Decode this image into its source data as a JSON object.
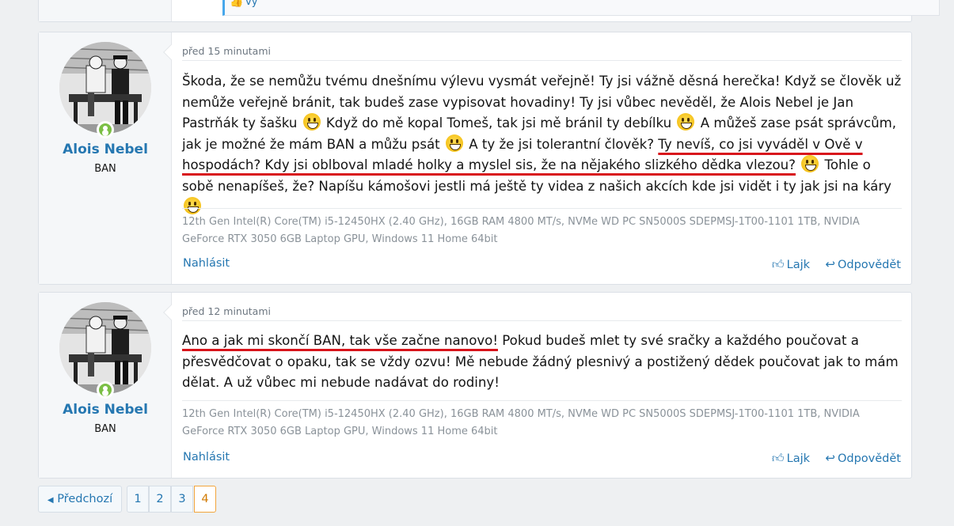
{
  "top_remnant": {
    "reaction_text": "vy"
  },
  "posts": [
    {
      "author": "Alois Nebel",
      "user_title": "BAN",
      "time": "před 15 minutami",
      "body": {
        "p1": "Škoda, že se nemůžu tvému dnešnímu výlevu vysmát veřejně! Ty jsi vážně děsná herečka! Když se člověk už nemůže veřejně bránit, tak budeš zase vypisovat hovadiny! Ty jsi vůbec nevěděl, že Alois Nebel je Jan Pastrňák ty šašku",
        "p2": "Když do mě kopal Tomeš, tak jsi mě bránil ty debílku",
        "p3": "A můžeš zase psát správcům, jak je možné že mám BAN a můžu psát",
        "p4": "A ty že jsi tolerantní člověk?",
        "p5_underlined": "Ty nevíš, co jsi vyváděl v Ově v hospodách? Kdy jsi oblboval mladé holky a myslel sis, že na nějakého slizkého dědka vlezou?",
        "p6": "Tohle o sobě nenapíšeš, že? Napíšu kámošovi jestli má ještě ty videa z našich akcích kde jsi vidět i ty jak jsi na káry"
      },
      "signature": "12th Gen Intel(R) Core(TM) i5-12450HX (2.40 GHz), 16GB RAM 4800 MT/s, NVMe WD PC SN5000S SDEPMSJ-1T00-1101 1TB, NVIDIA GeForce RTX 3050 6GB Laptop GPU, Windows 11 Home 64bit",
      "report_label": "Nahlásit",
      "like_label": "Lajk",
      "reply_label": "Odpovědět"
    },
    {
      "author": "Alois Nebel",
      "user_title": "BAN",
      "time": "před 12 minutami",
      "body": {
        "p1_underlined": "Ano a jak mi skončí BAN, tak vše začne nanovo!",
        "p2": "Pokud budeš mlet ty své sračky a každého poučovat a přesvědčovat o opaku, tak se vždy ozvu! Mě nebude žádný plesnivý a postižený dědek poučovat jak to mám dělat. A už vůbec mi nebude nadávat do rodiny!"
      },
      "signature": "12th Gen Intel(R) Core(TM) i5-12450HX (2.40 GHz), 16GB RAM 4800 MT/s, NVMe WD PC SN5000S SDEPMSJ-1T00-1101 1TB, NVIDIA GeForce RTX 3050 6GB Laptop GPU, Windows 11 Home 64bit",
      "report_label": "Nahlásit",
      "like_label": "Lajk",
      "reply_label": "Odpovědět"
    }
  ],
  "pagination": {
    "prev_label": "Předchozí",
    "pages": [
      "1",
      "2",
      "3",
      "4"
    ],
    "current": "4"
  },
  "colors": {
    "link": "#2577b1",
    "underline": "#d8141b",
    "online": "#7bbf45",
    "active_page": "#f2a53c"
  },
  "icons": [
    "thumbs-up-icon",
    "reply-arrow-icon",
    "online-badge-icon",
    "chevron-left-icon",
    "grin-smiley-icon"
  ]
}
